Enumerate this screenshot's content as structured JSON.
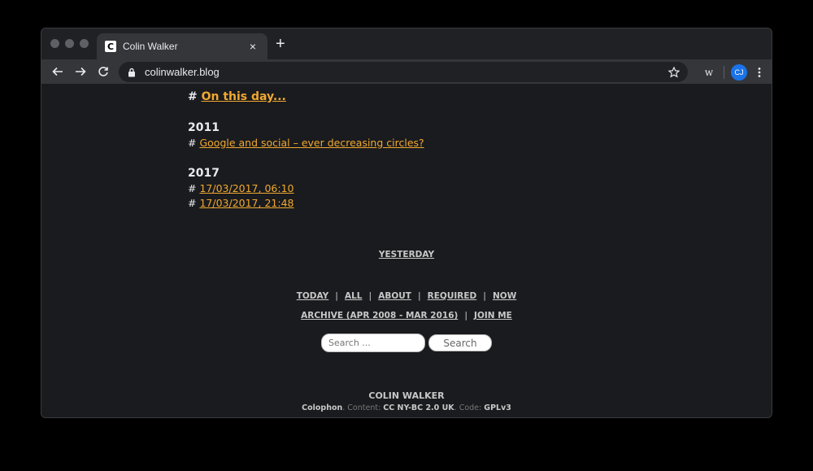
{
  "browser": {
    "tab_title": "Colin Walker",
    "favicon_letter": "C",
    "tab_close": "×",
    "new_tab": "+",
    "url": "colinwalker.blog",
    "extension_label": "w",
    "avatar_initials": "CJ"
  },
  "page": {
    "hash": "#",
    "heading_link": "On this day...",
    "years": [
      {
        "year": "2011",
        "posts": [
          "Google and social – ever decreasing circles?"
        ]
      },
      {
        "year": "2017",
        "posts": [
          "17/03/2017, 06:10",
          "17/03/2017, 21:48"
        ]
      }
    ]
  },
  "footer": {
    "yesterday": "YESTERDAY",
    "nav_row1": [
      "TODAY",
      "ALL",
      "ABOUT",
      "REQUIRED",
      "NOW"
    ],
    "nav_row2": [
      "ARCHIVE (APR 2008 - MAR 2016)",
      "JOIN ME"
    ],
    "pipe": "|",
    "search_placeholder": "Search ...",
    "search_button": "Search",
    "site_name": "COLIN WALKER",
    "colophon_label": "Colophon",
    "content_label": ". Content: ",
    "content_license": "CC NY-BC 2.0 UK",
    "code_label": ". Code: ",
    "code_license": "GPLv3"
  },
  "colors": {
    "link": "#f0a830",
    "background": "#1a1b1e",
    "chrome": "#35363a"
  }
}
